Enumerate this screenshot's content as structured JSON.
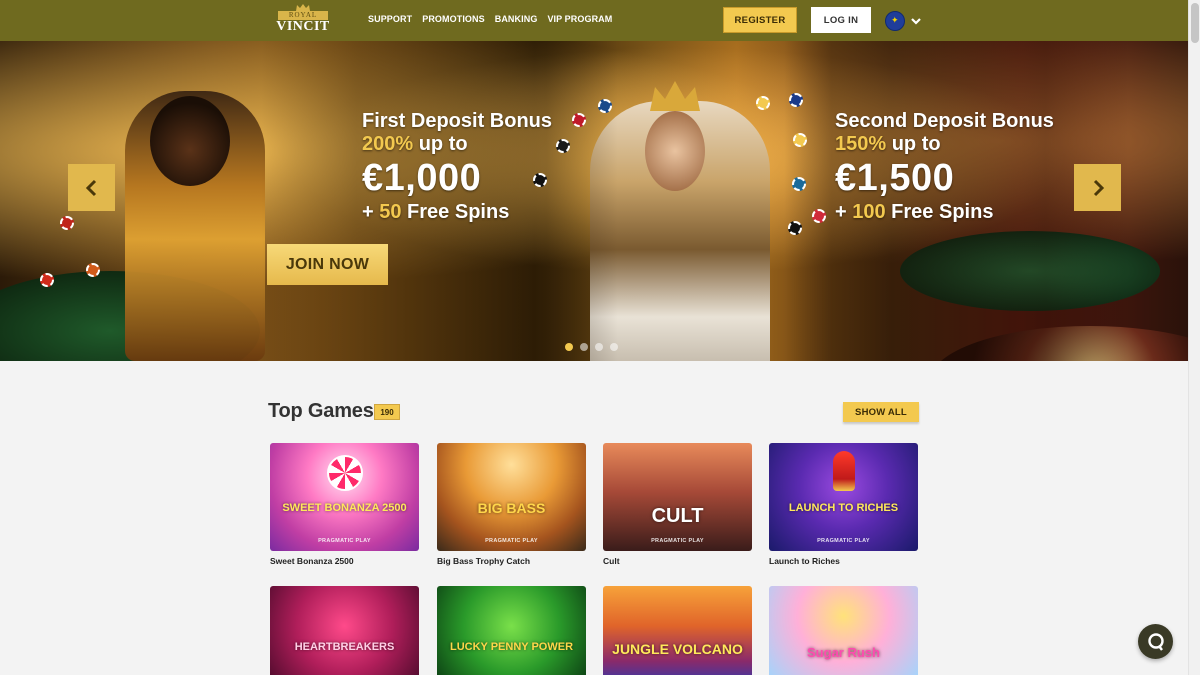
{
  "header": {
    "logo_top": "ROYAL",
    "logo_main": "VINCIT",
    "nav": [
      "SUPPORT",
      "PROMOTIONS",
      "BANKING",
      "VIP PROGRAM"
    ],
    "register_label": "REGISTER",
    "login_label": "LOG IN"
  },
  "hero": {
    "promo1": {
      "title": "First Deposit Bonus",
      "percent": "200%",
      "upto": " up to",
      "amount": "€1,000",
      "spins_prefix": "+ ",
      "spins_count": "50",
      "spins_suffix": " Free Spins"
    },
    "promo2": {
      "title": "Second Deposit Bonus",
      "percent": "150%",
      "upto": " up to",
      "amount": "€1,500",
      "spins_prefix": "+ ",
      "spins_count": "100",
      "spins_suffix": " Free Spins"
    },
    "join_label": "JOIN NOW",
    "active_slide": 1,
    "slide_count": 4
  },
  "top_games": {
    "title": "Top Games",
    "count": "190",
    "show_all_label": "SHOW ALL",
    "games": [
      {
        "name": "Sweet Bonanza 2500",
        "art_title": "SWEET BONANZA 2500",
        "provider": "PRAGMATIC PLAY"
      },
      {
        "name": "Big Bass Trophy Catch",
        "art_title": "BIG BASS",
        "provider": "PRAGMATIC PLAY"
      },
      {
        "name": "Cult",
        "art_title": "CULT",
        "provider": "PRAGMATIC PLAY"
      },
      {
        "name": "Launch to Riches",
        "art_title": "LAUNCH TO RICHES",
        "provider": "PRAGMATIC PLAY"
      },
      {
        "art_title": "HEARTBREAKERS"
      },
      {
        "art_title": "LUCKY PENNY POWER"
      },
      {
        "art_title": "JUNGLE VOLCANO"
      },
      {
        "art_title": "Sugar Rush"
      }
    ]
  },
  "colors": {
    "header_bg": "#6f6a1f",
    "accent_gold": "#f3c94f",
    "page_bg": "#f3f3f3"
  },
  "icons": {
    "language": "eu-flag-icon",
    "chat": "chat-icon",
    "prev": "chevron-left-icon",
    "next": "chevron-right-icon"
  }
}
